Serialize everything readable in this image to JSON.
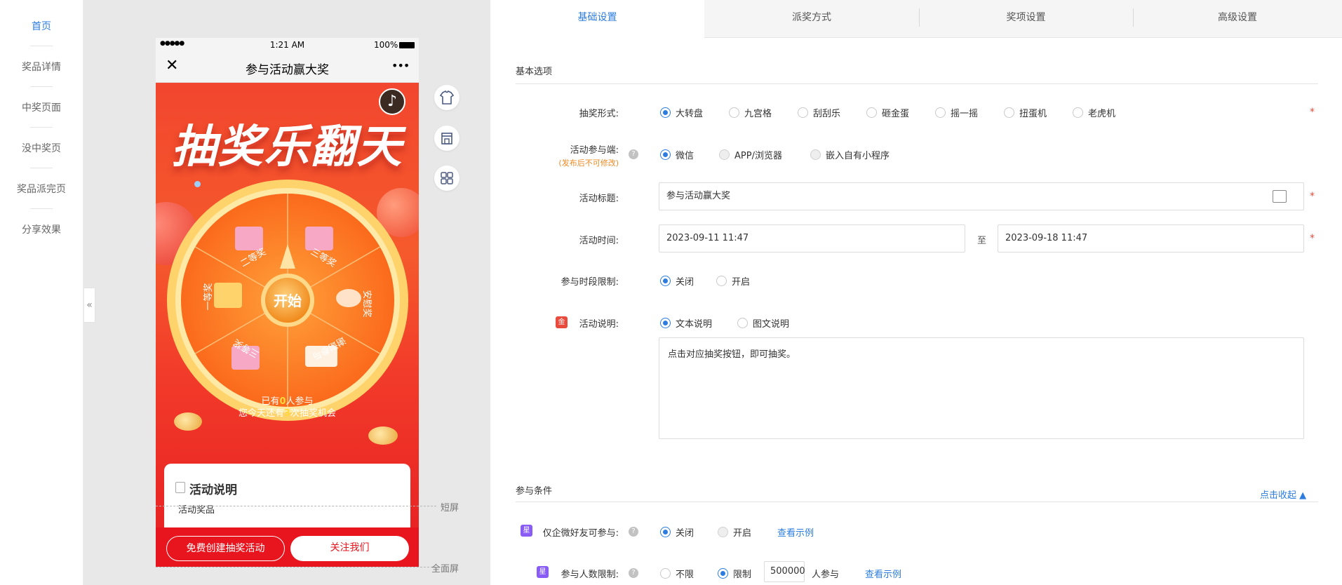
{
  "left_nav": {
    "items": [
      {
        "label": "首页",
        "active": true
      },
      {
        "label": "奖品详情",
        "active": false
      },
      {
        "label": "中奖页面",
        "active": false
      },
      {
        "label": "没中奖页",
        "active": false
      },
      {
        "label": "奖品派完页",
        "active": false
      },
      {
        "label": "分享效果",
        "active": false
      }
    ]
  },
  "preview": {
    "collapse_glyph": "«",
    "status": {
      "signal": "●●●●●",
      "time": "1:21 AM",
      "battery": "100%"
    },
    "nav": {
      "close_glyph": "✕",
      "title": "参与活动赢大奖",
      "more_glyph": "•••"
    },
    "hero_title": "抽奖乐翻天",
    "music_glyph": "♪",
    "wheel": {
      "center_label": "开始",
      "segments": [
        "二等奖",
        "三等奖",
        "安慰奖",
        "谢谢参与",
        "三等奖",
        "一等奖"
      ]
    },
    "participants_prefix": "已有",
    "participants_count": "0",
    "participants_suffix": "人参与",
    "chances_prefix": "您今天还有",
    "chances_count": "3",
    "chances_suffix": "次抽奖机会",
    "desc_card": {
      "title": "活动说明",
      "subtitle": "活动奖品"
    },
    "footer": {
      "create_btn": "免费创建抽奖活动",
      "follow_btn": "关注我们"
    },
    "screen_labels": {
      "short": "短屏",
      "full": "全面屏"
    },
    "tool_icons": [
      "shirt-icon",
      "store-icon",
      "grid-icon"
    ]
  },
  "tabs": [
    {
      "label": "基础设置",
      "active": true
    },
    {
      "label": "派奖方式",
      "active": false
    },
    {
      "label": "奖项设置",
      "active": false
    },
    {
      "label": "高级设置",
      "active": false
    }
  ],
  "basic": {
    "section_title": "基本选项",
    "draw_form": {
      "label": "抽奖形式:",
      "options": [
        "大转盘",
        "九宫格",
        "刮刮乐",
        "砸金蛋",
        "摇一摇",
        "扭蛋机",
        "老虎机"
      ],
      "selected": 0
    },
    "platform": {
      "label": "活动参与端:",
      "note": "(发布后不可修改)",
      "options": [
        "微信",
        "APP/浏览器",
        "嵌入自有小程序"
      ],
      "selected": 0
    },
    "title_field": {
      "label": "活动标题:",
      "value": "参与活动赢大奖"
    },
    "time_field": {
      "label": "活动时间:",
      "start": "2023-09-11 11:47",
      "separator": "至",
      "end": "2023-09-18 11:47"
    },
    "period_limit": {
      "label": "参与时段限制:",
      "options": [
        "关闭",
        "开启"
      ],
      "selected": 0
    },
    "description": {
      "label": "活动说明:",
      "badge": "金",
      "options": [
        "文本说明",
        "图文说明"
      ],
      "selected": 0,
      "text": "点击对应抽奖按钮，即可抽奖。"
    }
  },
  "conditions": {
    "section_title": "参与条件",
    "collapse_link": "点击收起 ▲",
    "wecom_friend": {
      "badge": "星",
      "label": "仅企微好友可参与:",
      "options": [
        "关闭",
        "开启"
      ],
      "selected": 0,
      "example_link": "查看示例"
    },
    "people_limit": {
      "badge": "星",
      "label": "参与人数限制:",
      "options": [
        "不限",
        "限制"
      ],
      "selected": 1,
      "value": "500000",
      "suffix": "人参与",
      "example_link": "查看示例"
    }
  },
  "colors": {
    "accent": "#2d7de0",
    "required": "#e84b3c",
    "note": "#f08a24",
    "phone_red": "#e8151e",
    "badge_gold": "#e84b3c",
    "badge_star": "#8a5cf6"
  }
}
